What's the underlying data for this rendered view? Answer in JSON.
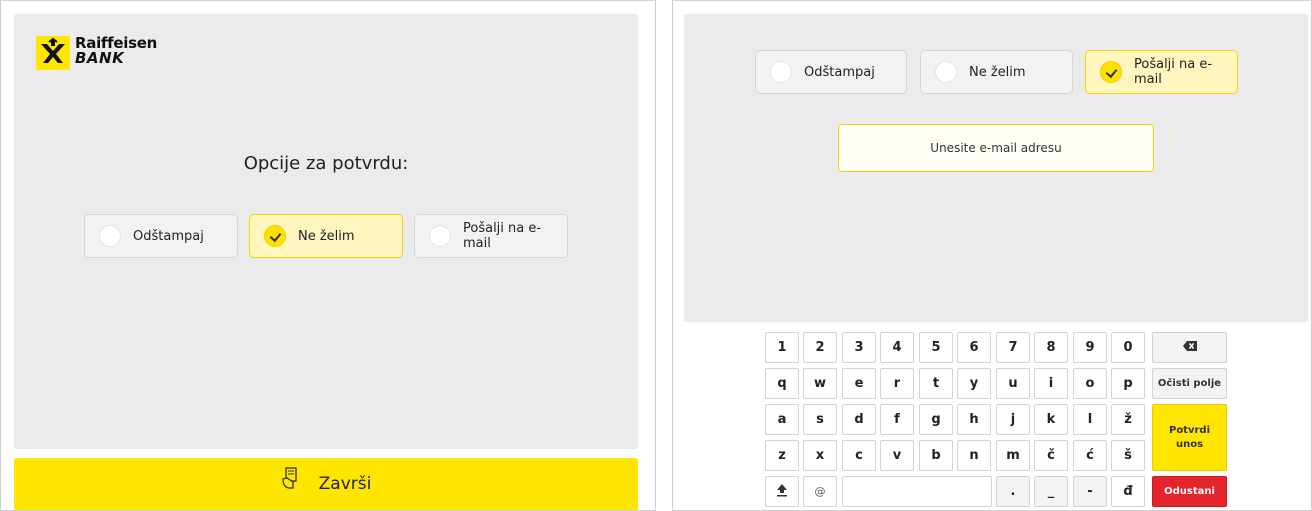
{
  "left": {
    "brand": {
      "name": "Raiffeisen",
      "sub": "BANK"
    },
    "heading": "Opcije za potvrdu:",
    "options": [
      {
        "label": "Odštampaj",
        "selected": false
      },
      {
        "label": "Ne želim",
        "selected": true
      },
      {
        "label": "Pošalji na e-mail",
        "selected": false
      }
    ],
    "finish_label": "Završi"
  },
  "right": {
    "options": [
      {
        "label": "Odštampaj",
        "selected": false
      },
      {
        "label": "Ne želim",
        "selected": false
      },
      {
        "label": "Pošalji na e-mail",
        "selected": true
      }
    ],
    "email_placeholder": "Unesite e-mail adresu",
    "keyboard": {
      "rows": [
        [
          "1",
          "2",
          "3",
          "4",
          "5",
          "6",
          "7",
          "8",
          "9",
          "0"
        ],
        [
          "q",
          "w",
          "e",
          "r",
          "t",
          "y",
          "u",
          "i",
          "o",
          "p"
        ],
        [
          "a",
          "s",
          "d",
          "f",
          "g",
          "h",
          "j",
          "k",
          "l",
          "ž"
        ],
        [
          "z",
          "x",
          "c",
          "v",
          "b",
          "n",
          "m",
          "č",
          "ć",
          "š"
        ]
      ],
      "bottom": {
        "at": "@",
        "dot": ".",
        "underscore": "_",
        "dash": "-",
        "dj": "đ"
      },
      "clear_label": "Očisti polje",
      "confirm_label": "Potvrdi unos",
      "cancel_label": "Odustani"
    }
  },
  "colors": {
    "accent": "#ffe500",
    "selected_bg": "#fff6bf",
    "panel": "#ebebeb",
    "cancel": "#e3242b"
  },
  "icons": [
    "raiffeisen-logo-icon",
    "checkmark-icon",
    "hand-receipt-icon",
    "backspace-icon",
    "shift-up-arrow-icon"
  ]
}
